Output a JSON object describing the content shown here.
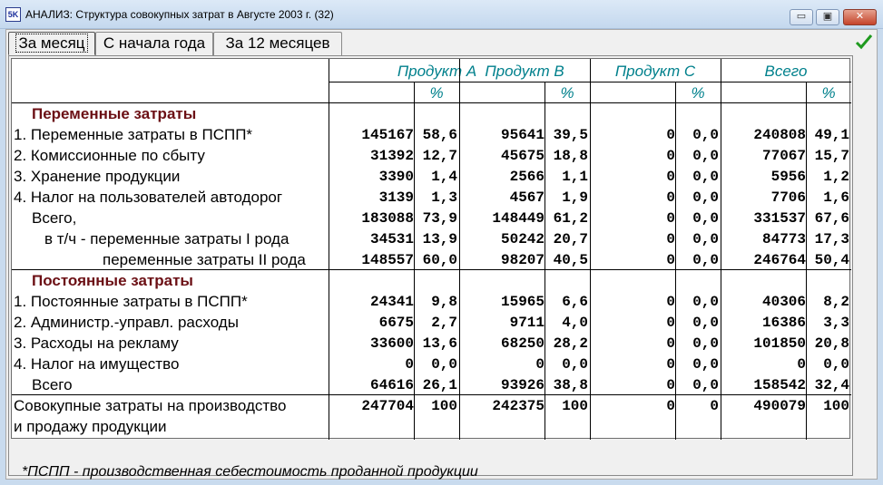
{
  "window": {
    "icon_text": "5K",
    "title": "АНАЛИЗ: Структура совокупных затрат в Августе 2003 г. (32)",
    "min_label": "▭",
    "max_label": "▣",
    "close_label": "✕"
  },
  "tabs": [
    {
      "label": "За месяц",
      "active": true
    },
    {
      "label": "С начала года",
      "active": false
    },
    {
      "label": "За 12 месяцев",
      "active": false
    }
  ],
  "table": {
    "headers": [
      "Продукт A",
      "Продукт B",
      "Продукт C",
      "Всего"
    ],
    "percent_label": "%",
    "sections": [
      {
        "title": "Переменные затраты",
        "rows": [
          {
            "label": "1. Переменные затраты в ПСПП*",
            "values": [
              "145167",
              "58,6",
              "95641",
              "39,5",
              "0",
              "0,0",
              "240808",
              "49,1"
            ]
          },
          {
            "label": "2. Комиссионные по сбыту",
            "values": [
              "31392",
              "12,7",
              "45675",
              "18,8",
              "0",
              "0,0",
              "77067",
              "15,7"
            ]
          },
          {
            "label": "3. Хранение продукции",
            "values": [
              "3390",
              "1,4",
              "2566",
              "1,1",
              "0",
              "0,0",
              "5956",
              "1,2"
            ]
          },
          {
            "label": "4. Налог на пользователей автодорог",
            "values": [
              "3139",
              "1,3",
              "4567",
              "1,9",
              "0",
              "0,0",
              "7706",
              "1,6"
            ]
          },
          {
            "label": "Всего,",
            "values": [
              "183088",
              "73,9",
              "148449",
              "61,2",
              "0",
              "0,0",
              "331537",
              "67,6"
            ]
          },
          {
            "label": "в т/ч - переменные затраты I рода",
            "values": [
              "34531",
              "13,9",
              "50242",
              "20,7",
              "0",
              "0,0",
              "84773",
              "17,3"
            ]
          },
          {
            "label": "переменные затраты II рода",
            "values": [
              "148557",
              "60,0",
              "98207",
              "40,5",
              "0",
              "0,0",
              "246764",
              "50,4"
            ]
          }
        ]
      },
      {
        "title": "Постоянные затраты",
        "rows": [
          {
            "label": "1. Постоянные затраты в ПСПП*",
            "values": [
              "24341",
              "9,8",
              "15965",
              "6,6",
              "0",
              "0,0",
              "40306",
              "8,2"
            ]
          },
          {
            "label": "2. Администр.-управл. расходы",
            "values": [
              "6675",
              "2,7",
              "9711",
              "4,0",
              "0",
              "0,0",
              "16386",
              "3,3"
            ]
          },
          {
            "label": "3. Расходы на рекламу",
            "values": [
              "33600",
              "13,6",
              "68250",
              "28,2",
              "0",
              "0,0",
              "101850",
              "20,8"
            ]
          },
          {
            "label": "4. Налог на имущество",
            "values": [
              "0",
              "0,0",
              "0",
              "0,0",
              "0",
              "0,0",
              "0",
              "0,0"
            ]
          },
          {
            "label": "Всего",
            "values": [
              "64616",
              "26,1",
              "93926",
              "38,8",
              "0",
              "0,0",
              "158542",
              "32,4"
            ]
          }
        ]
      }
    ],
    "total": {
      "label_line1": "Совокупные затраты на производство",
      "label_line2": "и продажу продукции",
      "values": [
        "247704",
        "100",
        "242375",
        "100",
        "0",
        "0",
        "490079",
        "100"
      ]
    }
  },
  "footnote": "*ПСПП - производственная себестоимость проданной продукции",
  "colors": {
    "header_text": "#00808c",
    "section_text": "#6b0f14",
    "ok_check": "#1f9a1f"
  }
}
